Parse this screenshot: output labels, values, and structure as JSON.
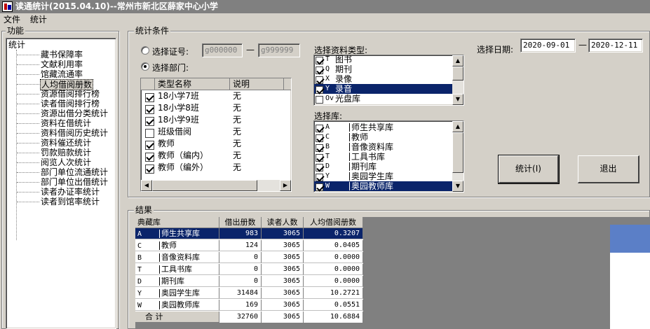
{
  "window": {
    "title": "读通统计(2015.04.10)--常州市新北区薛家中心小学"
  },
  "menu": [
    "文件",
    "统计"
  ],
  "func_panel": {
    "label": "功能",
    "root": "统计",
    "items": [
      "藏书保障率",
      "文献利用率",
      "馆藏流通率",
      "人均借阅册数",
      "资源借阅排行榜",
      "读者借阅排行榜",
      "资源出借分类统计",
      "资料在借统计",
      "资料借阅历史统计",
      "资料催还统计",
      "罚款赔款统计",
      "阅览人次统计",
      "部门单位流通统计",
      "部门单位出借统计",
      "读者办证率统计",
      "读者到馆率统计"
    ],
    "selected_index": 3
  },
  "conditions": {
    "label": "统计条件",
    "radio_card": "选择证号:",
    "radio_dept": "选择部门:",
    "card_from": "g000000",
    "card_to": "g999999",
    "dash": "—",
    "dept_headers": [
      "类型名称",
      "说明"
    ],
    "depts": [
      {
        "name": "18小学7班",
        "desc": "无",
        "checked": true
      },
      {
        "name": "18小学8班",
        "desc": "无",
        "checked": true
      },
      {
        "name": "18小学9班",
        "desc": "无",
        "checked": true
      },
      {
        "name": "班级借阅",
        "desc": "无",
        "checked": false
      },
      {
        "name": "教师",
        "desc": "无",
        "checked": true
      },
      {
        "name": "教师（编内）",
        "desc": "无",
        "checked": true
      },
      {
        "name": "教师（编外）",
        "desc": "无",
        "checked": true
      }
    ],
    "type_label": "选择资料类型:",
    "types": [
      {
        "code": "T",
        "name": "图书",
        "checked": true
      },
      {
        "code": "Q",
        "name": "期刊",
        "checked": true
      },
      {
        "code": "X",
        "name": "录像",
        "checked": true
      },
      {
        "code": "Y",
        "name": "录音",
        "checked": true,
        "selected": true
      },
      {
        "code": "Ov",
        "name": "光盘库",
        "checked": false
      }
    ],
    "lib_label": "选择库:",
    "libs": [
      {
        "code": "A",
        "name": "师生共享库",
        "checked": true
      },
      {
        "code": "C",
        "name": "教师",
        "checked": true
      },
      {
        "code": "B",
        "name": "音像资料库",
        "checked": true
      },
      {
        "code": "T",
        "name": "工具书库",
        "checked": true
      },
      {
        "code": "D",
        "name": "期刊库",
        "checked": true
      },
      {
        "code": "Y",
        "name": "奥园学生库",
        "checked": true
      },
      {
        "code": "W",
        "name": "奥园教师库",
        "checked": true,
        "selected": true
      }
    ],
    "date_label": "选择日期:",
    "date_from": "2020-09-01",
    "date_to": "2020-12-11",
    "stat_button": "统计(I)",
    "exit_button": "退出"
  },
  "results": {
    "label": "结果",
    "headers": [
      "典藏库",
      "借出册数",
      "读者人数",
      "人均借阅册数"
    ],
    "rows": [
      {
        "code": "A",
        "name": "师生共享库",
        "borrowed": "983",
        "readers": "3065",
        "avg": "0.3207"
      },
      {
        "code": "C",
        "name": "教师",
        "borrowed": "124",
        "readers": "3065",
        "avg": "0.0405"
      },
      {
        "code": "B",
        "name": "音像资料库",
        "borrowed": "0",
        "readers": "3065",
        "avg": "0.0000"
      },
      {
        "code": "T",
        "name": "工具书库",
        "borrowed": "0",
        "readers": "3065",
        "avg": "0.0000"
      },
      {
        "code": "D",
        "name": "期刊库",
        "borrowed": "0",
        "readers": "3065",
        "avg": "0.0000"
      },
      {
        "code": "Y",
        "name": "奥园学生库",
        "borrowed": "31484",
        "readers": "3065",
        "avg": "10.2721"
      },
      {
        "code": "W",
        "name": "奥园教师库",
        "borrowed": "169",
        "readers": "3065",
        "avg": "0.0551"
      }
    ],
    "total": {
      "label": "合 计",
      "borrowed": "32760",
      "readers": "3065",
      "avg": "10.6884"
    }
  },
  "colors": {
    "face": "#d4d0c8",
    "selection": "#0a246a",
    "grid_bg": "#808080",
    "title": "#808080"
  }
}
